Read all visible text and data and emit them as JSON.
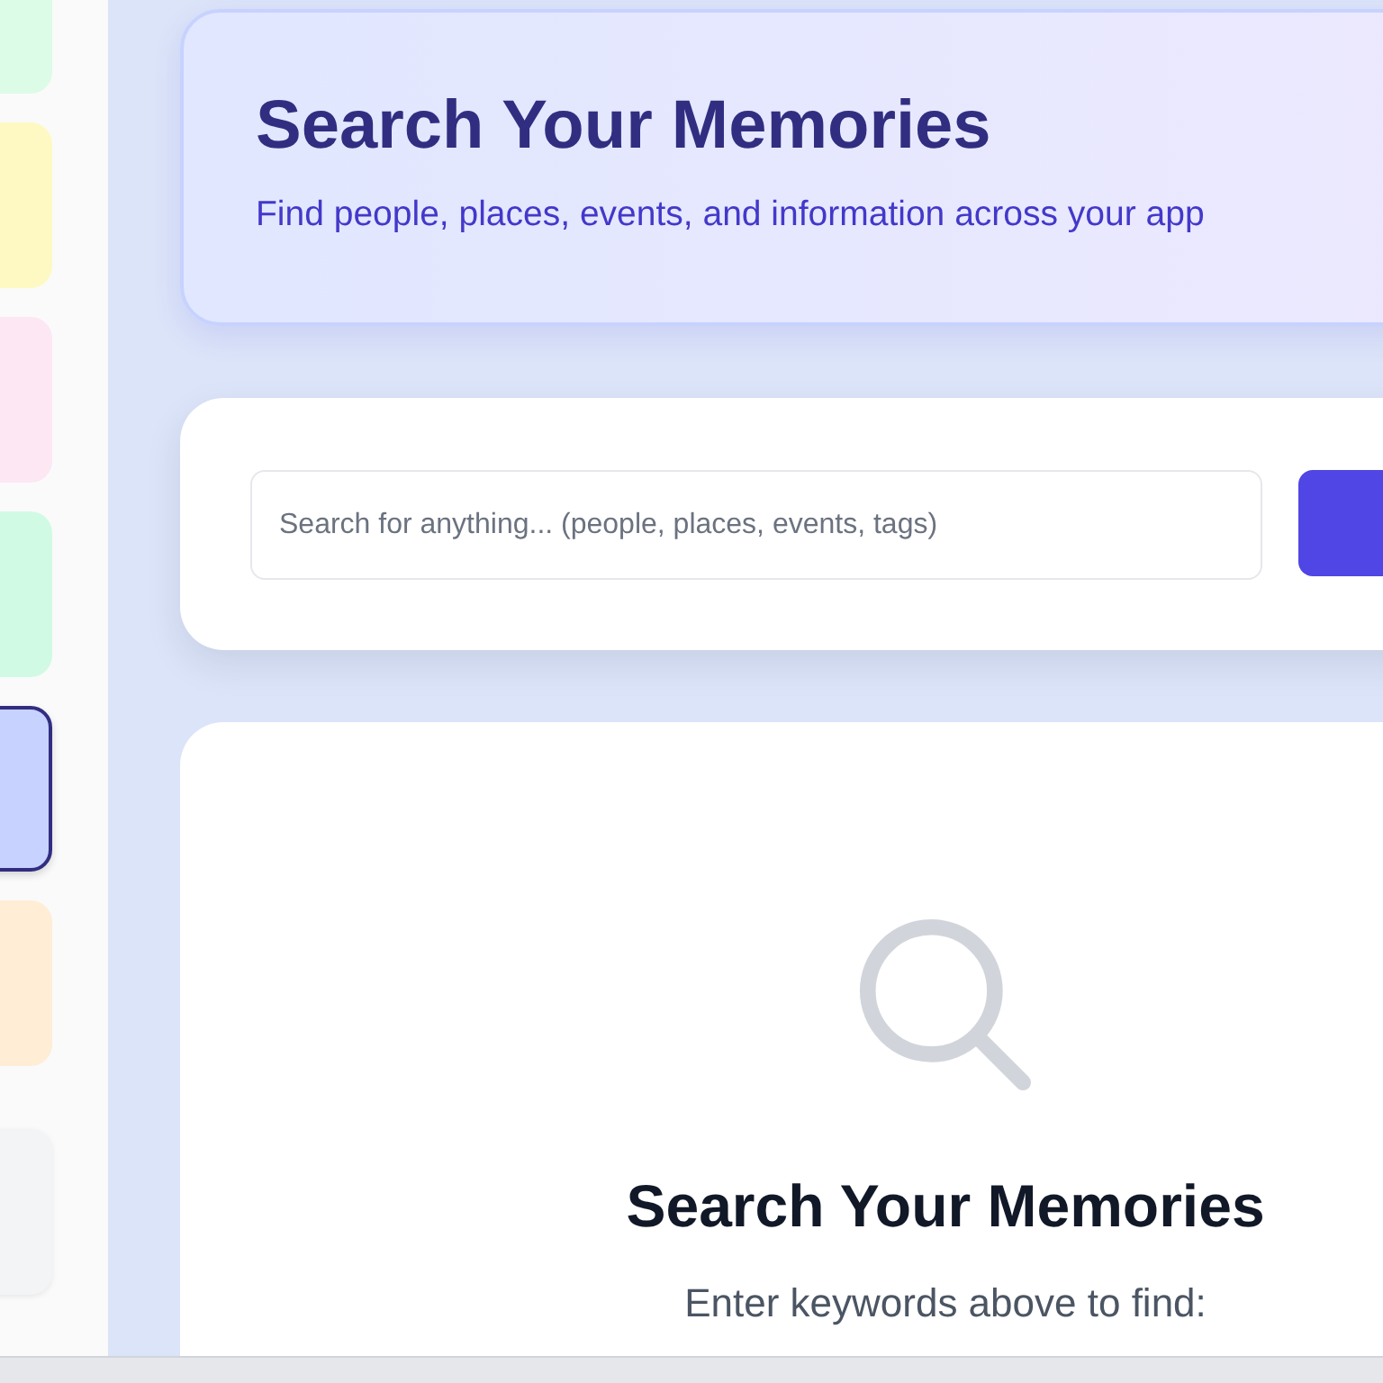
{
  "sidebar": {
    "tiles": [
      {
        "color": "#dcfce7",
        "selected": false
      },
      {
        "color": "#fef9c3",
        "selected": false
      },
      {
        "color": "#fce7f3",
        "selected": false
      },
      {
        "color": "#d1fae5",
        "selected": false
      },
      {
        "color": "#c7d2fe",
        "selected": true
      },
      {
        "color": "#ffedd5",
        "selected": false
      },
      {
        "color": "#f3f4f6",
        "selected": false
      }
    ]
  },
  "header": {
    "title": "Search Your Memories",
    "subtitle": "Find people, places, events, and information across your app"
  },
  "search": {
    "placeholder": "Search for anything... (people, places, events, tags)"
  },
  "empty_state": {
    "title": "Search Your Memories",
    "text": "Enter keywords above to find:"
  }
}
